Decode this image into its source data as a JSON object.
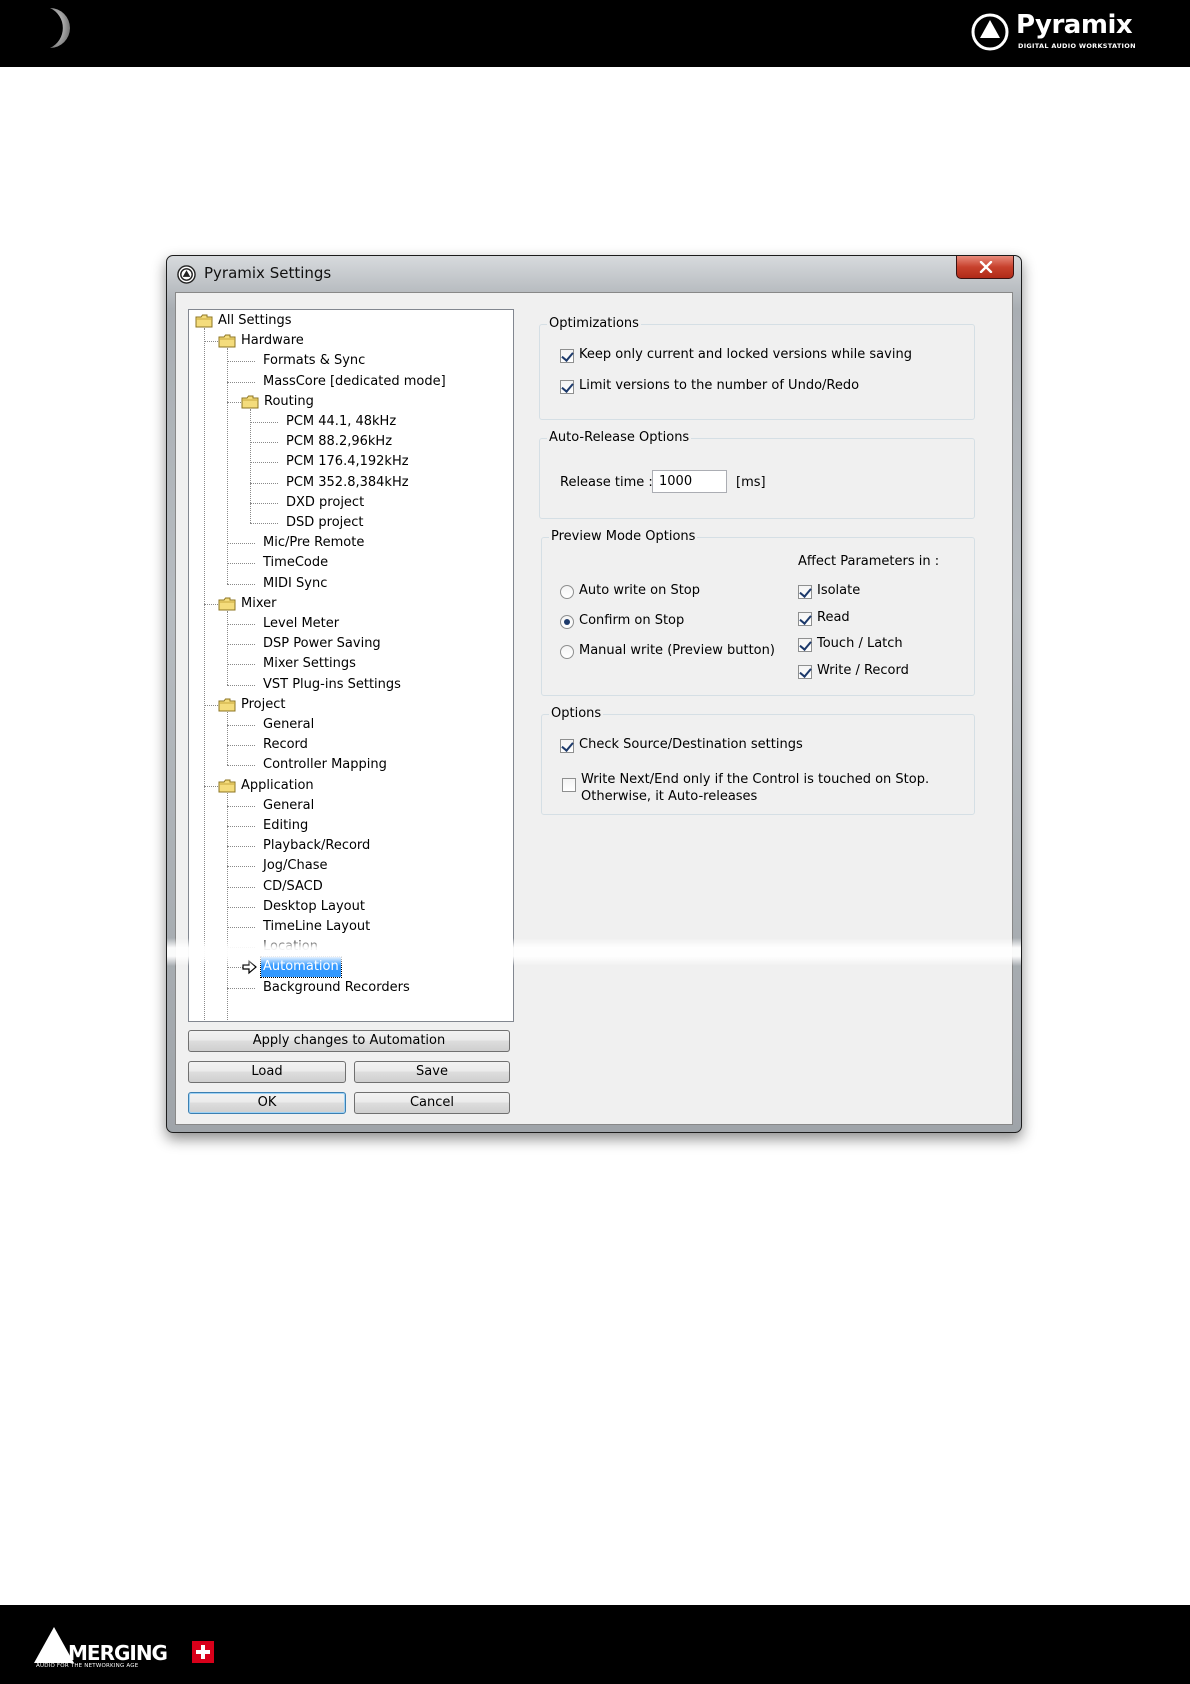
{
  "header": {
    "brand_name": "Pyramix",
    "brand_tagline": "DIGITAL AUDIO WORKSTATION"
  },
  "footer": {
    "brand_name": "MERGING",
    "brand_tagline": "AUDIO FOR THE NETWORKING AGE"
  },
  "dialog": {
    "title": "Pyramix Settings",
    "close_label": "x"
  },
  "tree": {
    "items": [
      {
        "label": "All Settings",
        "level": 0,
        "folder": true
      },
      {
        "label": "Hardware",
        "level": 1,
        "folder": true
      },
      {
        "label": "Formats & Sync",
        "level": 2
      },
      {
        "label": "MassCore [dedicated mode]",
        "level": 2
      },
      {
        "label": "Routing",
        "level": 2,
        "folder": true
      },
      {
        "label": "PCM 44.1, 48kHz",
        "level": 3
      },
      {
        "label": "PCM 88.2,96kHz",
        "level": 3
      },
      {
        "label": "PCM 176.4,192kHz",
        "level": 3
      },
      {
        "label": "PCM 352.8,384kHz",
        "level": 3
      },
      {
        "label": "DXD project",
        "level": 3
      },
      {
        "label": "DSD project",
        "level": 3
      },
      {
        "label": "Mic/Pre Remote",
        "level": 2
      },
      {
        "label": "TimeCode",
        "level": 2
      },
      {
        "label": "MIDI Sync",
        "level": 2
      },
      {
        "label": "Mixer",
        "level": 1,
        "folder": true
      },
      {
        "label": "Level Meter",
        "level": 2
      },
      {
        "label": "DSP Power Saving",
        "level": 2
      },
      {
        "label": "Mixer Settings",
        "level": 2
      },
      {
        "label": "VST Plug-ins Settings",
        "level": 2
      },
      {
        "label": "Project",
        "level": 1,
        "folder": true
      },
      {
        "label": "General",
        "level": 2
      },
      {
        "label": "Record",
        "level": 2
      },
      {
        "label": "Controller Mapping",
        "level": 2
      },
      {
        "label": "Application",
        "level": 1,
        "folder": true
      },
      {
        "label": "General",
        "level": 2
      },
      {
        "label": "Editing",
        "level": 2
      },
      {
        "label": "Playback/Record",
        "level": 2
      },
      {
        "label": "Jog/Chase",
        "level": 2
      },
      {
        "label": "CD/SACD",
        "level": 2
      },
      {
        "label": "Desktop Layout",
        "level": 2
      },
      {
        "label": "TimeLine Layout",
        "level": 2
      },
      {
        "label": "Location",
        "level": 2
      },
      {
        "label": "Automation",
        "level": 2,
        "selected": true
      },
      {
        "label": "Background Recorders",
        "level": 2
      }
    ]
  },
  "buttons": {
    "apply": "Apply changes to Automation",
    "load": "Load",
    "save": "Save",
    "ok": "OK",
    "cancel": "Cancel"
  },
  "optimizations": {
    "title": "Optimizations",
    "keep_versions": {
      "label": "Keep only current and locked versions while saving",
      "checked": true
    },
    "limit_versions": {
      "label": "Limit versions to the number of Undo/Redo",
      "checked": true
    }
  },
  "auto_release": {
    "title": "Auto-Release Options",
    "release_label": "Release time :",
    "release_value": "1000",
    "unit": "[ms]"
  },
  "preview_mode": {
    "title": "Preview Mode Options",
    "radios": [
      {
        "label": "Auto write on Stop",
        "selected": false
      },
      {
        "label": "Confirm on Stop",
        "selected": true
      },
      {
        "label": "Manual write (Preview button)",
        "selected": false
      }
    ],
    "affect_title": "Affect Parameters in :",
    "affect": [
      {
        "label": "Isolate",
        "checked": true
      },
      {
        "label": "Read",
        "checked": true
      },
      {
        "label": "Touch / Latch",
        "checked": true
      },
      {
        "label": "Write / Record",
        "checked": true
      }
    ]
  },
  "options": {
    "title": "Options",
    "check_source": {
      "label": "Check Source/Destination settings",
      "checked": true
    },
    "write_next_line1": "Write Next/End only if the Control is touched on Stop.",
    "write_next_line2": "Otherwise, it Auto-releases",
    "write_next_checked": false
  }
}
